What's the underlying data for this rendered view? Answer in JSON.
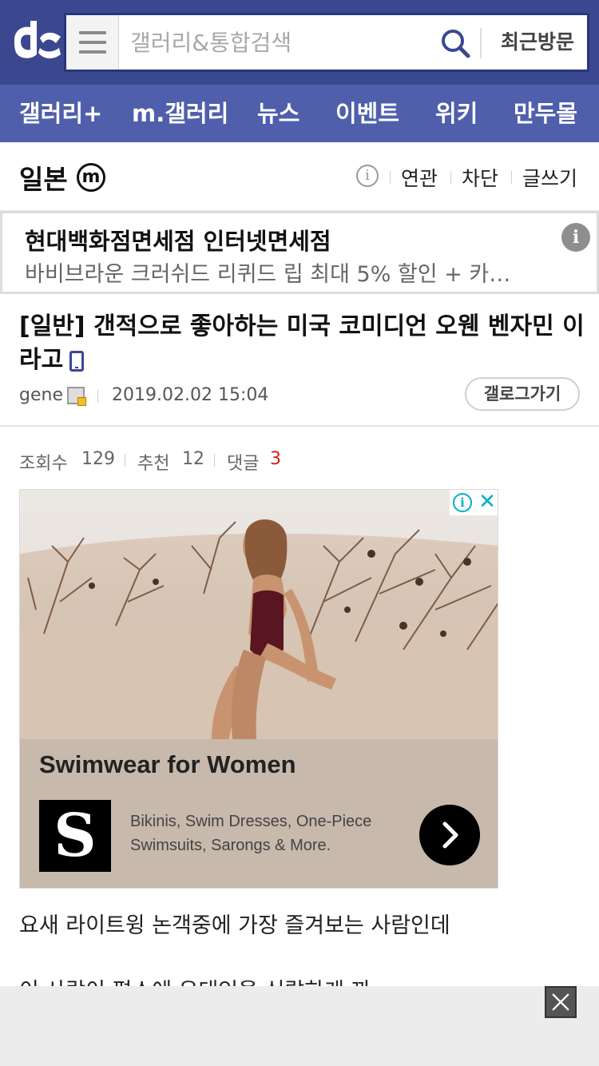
{
  "header": {
    "logo_icon": "dc-logo",
    "search": {
      "placeholder": "갤러리&통합검색",
      "value": ""
    },
    "recent_label": "최근방문"
  },
  "nav": {
    "items": [
      {
        "label": "갤러리+"
      },
      {
        "label": "m.갤러리"
      },
      {
        "label": "뉴스"
      },
      {
        "label": "이벤트"
      },
      {
        "label": "위키"
      },
      {
        "label": "만두몰"
      }
    ]
  },
  "gallery": {
    "title": "일본",
    "mark": "m",
    "info_icon": "info-icon",
    "links": [
      "연관",
      "차단",
      "글쓰기"
    ]
  },
  "top_ad": {
    "title": "현대백화점면세점 인터넷면세점",
    "description": "바비브라운 크러쉬드 리퀴드 립 최대 5% 할인 + 카…",
    "info_icon": "i"
  },
  "post": {
    "title": "[일반] 갠적으로 좋아하는 미국 코미디언 오웬 벤자민 이라고",
    "author": "gene",
    "date": "2019.02.02 15:04",
    "gallog_label": "갤로그가기",
    "stats": {
      "views_label": "조회수",
      "views": "129",
      "recommend_label": "추천",
      "recommend": "12",
      "reply_label": "댓글",
      "reply": "3"
    }
  },
  "image_ad": {
    "headline": "Swimwear for Women",
    "brand_letter": "S",
    "body": "Bikinis, Swim Dresses, One-Piece Swimsuits, Sarongs & More.",
    "adchoice_info": "i",
    "adchoice_close": "✕"
  },
  "content": {
    "line1": "요새 라이트윙 논객중에 가장 즐겨보는 사람인데",
    "line2": "이 사람이 평소에 유대인을 신랄하게 까"
  },
  "colors": {
    "header_bg": "#3b4890",
    "nav_bg": "#4f5fab",
    "reply_count": "#d31c1c",
    "adchoice": "#00aecd"
  }
}
